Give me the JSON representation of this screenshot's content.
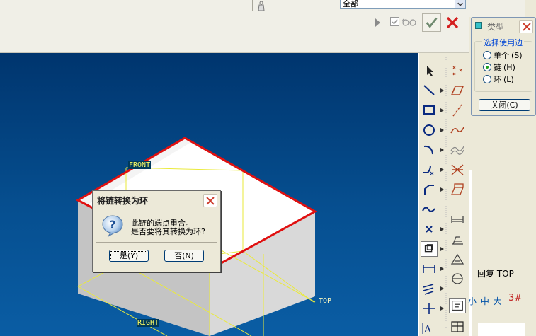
{
  "toolbar": {
    "filter_value": "全部",
    "icons": [
      "weight-icon",
      "play-icon",
      "checkbox-icon",
      "glasses-icon",
      "checkmark-icon",
      "close-icon"
    ]
  },
  "viewport": {
    "labels": {
      "front": "FRONT",
      "right": "RIGHT",
      "top": "TOP"
    },
    "colors": {
      "background": "#004a8c",
      "highlight_edge": "#e01010",
      "datum": "#f0f040"
    }
  },
  "type_dialog": {
    "title": "类型",
    "group_label": "选择使用边",
    "options": [
      {
        "label": "单个",
        "key": "S",
        "selected": false
      },
      {
        "label": "链",
        "key": "H",
        "selected": true
      },
      {
        "label": "环",
        "key": "L",
        "selected": false
      }
    ],
    "close_label": "关闭(C)"
  },
  "side_panel": {
    "restore_label": "回复 TOP",
    "size_label": "小 中 大",
    "size_value": "3#"
  },
  "modal": {
    "title": "将链转换为环",
    "line1": "此链的端点重合。",
    "line2": "是否要将其转换为环?",
    "yes_label": "是(Y)",
    "no_label": "否(N)"
  }
}
